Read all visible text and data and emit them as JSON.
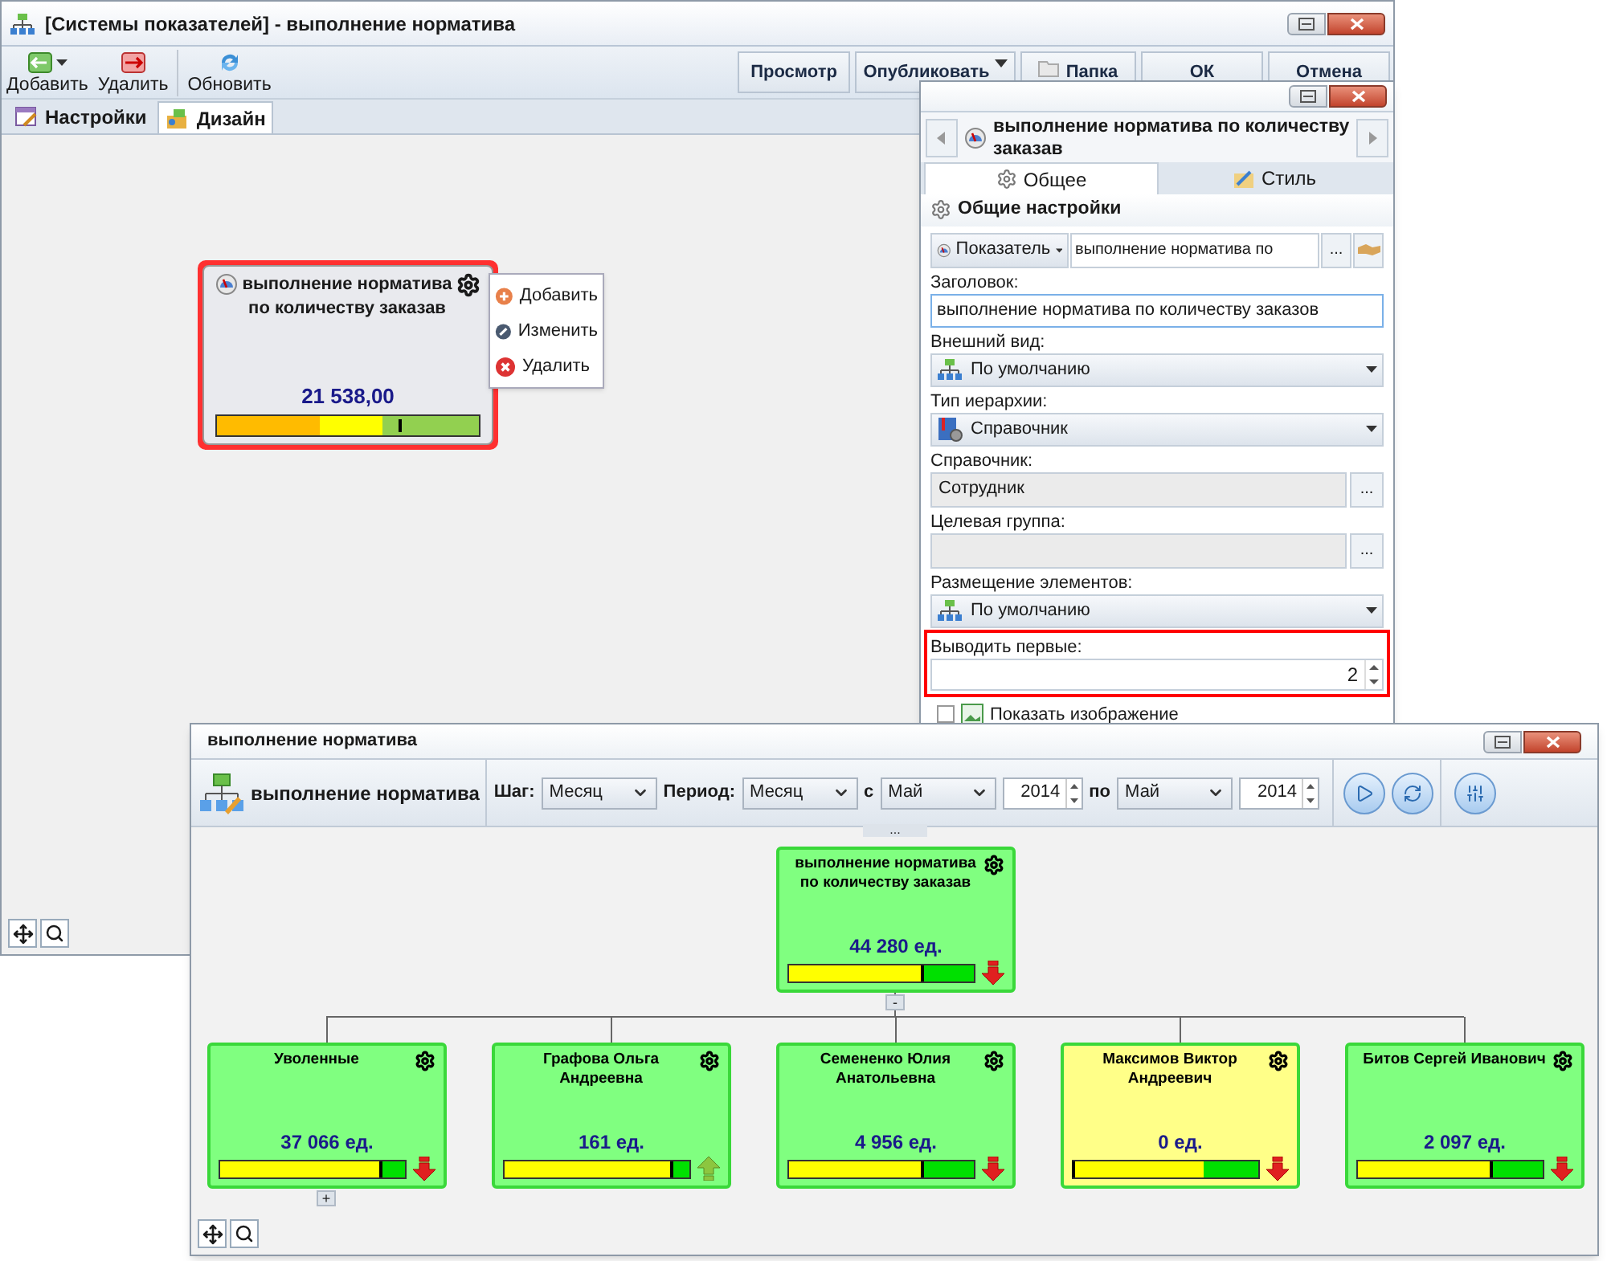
{
  "main_window": {
    "title": "[Системы показателей] - выполнение норматива",
    "toolbar": [
      {
        "label": "Добавить",
        "kind": "add",
        "has_menu": true
      },
      {
        "label": "Удалить",
        "kind": "delete",
        "has_menu": false
      },
      {
        "label": "Обновить",
        "kind": "refresh",
        "has_menu": false
      }
    ],
    "actions": [
      {
        "label": "Просмотр",
        "kind": "plain"
      },
      {
        "label": "Опубликовать",
        "kind": "dropdown"
      },
      {
        "label": "Папка",
        "kind": "folder"
      },
      {
        "label": "ОК",
        "kind": "plain"
      },
      {
        "label": "Отмена",
        "kind": "plain"
      }
    ],
    "tabs": [
      {
        "label": "Настройки",
        "selected": false
      },
      {
        "label": "Дизайн",
        "selected": true
      }
    ],
    "card": {
      "title": "выполнение норматива по количеству заказав",
      "value": "21 538,00",
      "level": 0.7,
      "selected": true
    },
    "context_menu": [
      {
        "label": "Добавить",
        "kind": "add"
      },
      {
        "label": "Изменить",
        "kind": "edit"
      },
      {
        "label": "Удалить",
        "kind": "delete"
      }
    ]
  },
  "properties_panel": {
    "title": "выполнение норматива по количеству заказав",
    "tabs": [
      {
        "label": "Общее",
        "selected": true
      },
      {
        "label": "Стиль",
        "selected": false
      }
    ],
    "section": "Общие настройки",
    "source": {
      "type": "Показатель",
      "value": "выполнение норматива по",
      "button": "..."
    },
    "fields": [
      {
        "label": "Заголовок:",
        "kind": "text",
        "value": "выполнение норматива по количеству заказов",
        "highlighted": false
      },
      {
        "label": "Внешний вид:",
        "kind": "select",
        "value": "По умолчанию",
        "highlighted": false
      },
      {
        "label": "Тип иерархии:",
        "kind": "select",
        "value": "Справочник",
        "highlighted": false
      },
      {
        "label": "Справочник:",
        "kind": "lookup",
        "value": "Сотрудник",
        "button": "...",
        "highlighted": false
      },
      {
        "label": "Целевая группа:",
        "kind": "lookup",
        "button": "...",
        "highlighted": false
      },
      {
        "label": "Размещение элементов:",
        "kind": "select",
        "value": "По умолчанию",
        "highlighted": false
      },
      {
        "label": "Выводить первые:",
        "kind": "spin",
        "value": "2",
        "highlighted": true
      }
    ],
    "checkbox": {
      "label": "Показать изображение",
      "checked": false
    }
  },
  "report_window": {
    "title": "выполнение норматива",
    "toolbar": {
      "name": "выполнение норматива",
      "step_label": "Шаг:",
      "step": "Месяц",
      "period_label": "Период:",
      "period": "Месяц",
      "from_label": "с",
      "from_month": "Май",
      "from_year": "2014",
      "to_label": "по",
      "to_month": "Май",
      "to_year": "2014"
    },
    "top_handle": "...",
    "root": {
      "title": "выполнение норматива по количеству заказав",
      "value": "44 280 ед.",
      "level": 0.72,
      "kind": "down",
      "color": "#80ff80",
      "toggle": "-"
    },
    "children": [
      {
        "title": "Уволенные",
        "value": "37 066 ед.",
        "level": 0.87,
        "kind": "down",
        "color": "#80ff80",
        "toggle": "+"
      },
      {
        "title": "Графова Ольга Андреевна",
        "value": "161 ед.",
        "level": 0.9,
        "kind": "up",
        "color": "#80ff80"
      },
      {
        "title": "Семененко Юлия Анатольевна",
        "value": "4 956 ед.",
        "level": 0.72,
        "kind": "down",
        "color": "#80ff80"
      },
      {
        "title": "Максимов Виктор Андреевич",
        "value": "0 ед.",
        "level": 0,
        "kind": "down",
        "color": "#ffff88"
      },
      {
        "title": "Битов Сергей Иванович",
        "value": "2 097 ед.",
        "level": 0.72,
        "kind": "down",
        "color": "#80ff80"
      }
    ]
  }
}
